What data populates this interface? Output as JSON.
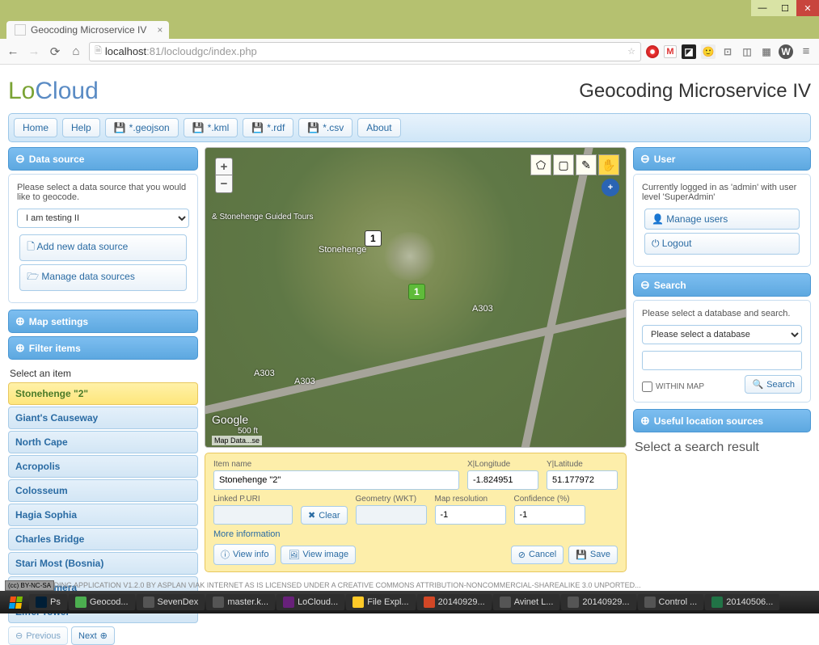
{
  "browser": {
    "tab_title": "Geocoding Microservice IV",
    "url_host": "localhost",
    "url_path": ":81/locloudgc/index.php"
  },
  "header": {
    "logo_lo": "Lo",
    "logo_cloud": "Cloud",
    "title": "Geocoding Microservice IV"
  },
  "toolbar": {
    "home": "Home",
    "help": "Help",
    "geojson": "*.geojson",
    "kml": "*.kml",
    "rdf": "*.rdf",
    "csv": "*.csv",
    "about": "About"
  },
  "data_source": {
    "title": "Data source",
    "prompt": "Please select a data source that you would like to geocode.",
    "selected": "I am testing II",
    "add_new": "Add new data source",
    "manage": "Manage data sources"
  },
  "map_settings_title": "Map settings",
  "filter_items_title": "Filter items",
  "select_item_label": "Select an item",
  "items": [
    "Stonehenge \"2\"",
    "Giant's Causeway",
    "North Cape",
    "Acropolis",
    "Colosseum",
    "Hagia Sophia",
    "Charles Bridge",
    "Stari Most (Bosnia)",
    "Kunstkamera",
    "Eiffel Tower"
  ],
  "pager": {
    "prev": "Previous",
    "next": "Next"
  },
  "map": {
    "marker1": "1",
    "marker2": "1",
    "road": "A303",
    "stonehenge": "Stonehenge",
    "tours": "& Stonehenge Guided Tours",
    "google": "Google",
    "scale": "500 ft",
    "attrib": "Map Data...se"
  },
  "form": {
    "item_name_lbl": "Item name",
    "item_name_val": "Stonehenge \"2\"",
    "x_lbl": "X|Longitude",
    "x_val": "-1.824951",
    "y_lbl": "Y|Latitude",
    "y_val": "51.177972",
    "linked_lbl": "Linked P.URI",
    "linked_val": "",
    "geom_lbl": "Geometry (WKT)",
    "geom_val": "",
    "res_lbl": "Map resolution",
    "res_val": "-1",
    "conf_lbl": "Confidence (%)",
    "conf_val": "-1",
    "clear": "Clear",
    "more": "More information",
    "view_info": "View info",
    "view_image": "View image",
    "cancel": "Cancel",
    "save": "Save"
  },
  "user": {
    "title": "User",
    "status": "Currently logged in as 'admin' with user level 'SuperAdmin'",
    "manage": "Manage users",
    "logout": "Logout"
  },
  "search": {
    "title": "Search",
    "prompt": "Please select a database and search.",
    "db_placeholder": "Please select a database",
    "within": "WITHIN MAP",
    "btn": "Search"
  },
  "useful_title": "Useful location sources",
  "search_result_label": "Select a search result",
  "footer": "...UD GEOCODING APPLICATION V1.2.0 BY ASPLAN VIAK INTERNET AS IS LICENSED UNDER A CREATIVE COMMONS ATTRIBUTION-NONCOMMERCIAL-SHAREALIKE 3.0 UNPORTED...",
  "cc": "(cc) BY-NC-SA",
  "taskbar": [
    "Ps",
    "Geocod...",
    "SevenDex",
    "master.k...",
    "LoCloud...",
    "File Expl...",
    "20140929...",
    "Avinet L...",
    "20140929...",
    "Control ...",
    "20140506..."
  ]
}
